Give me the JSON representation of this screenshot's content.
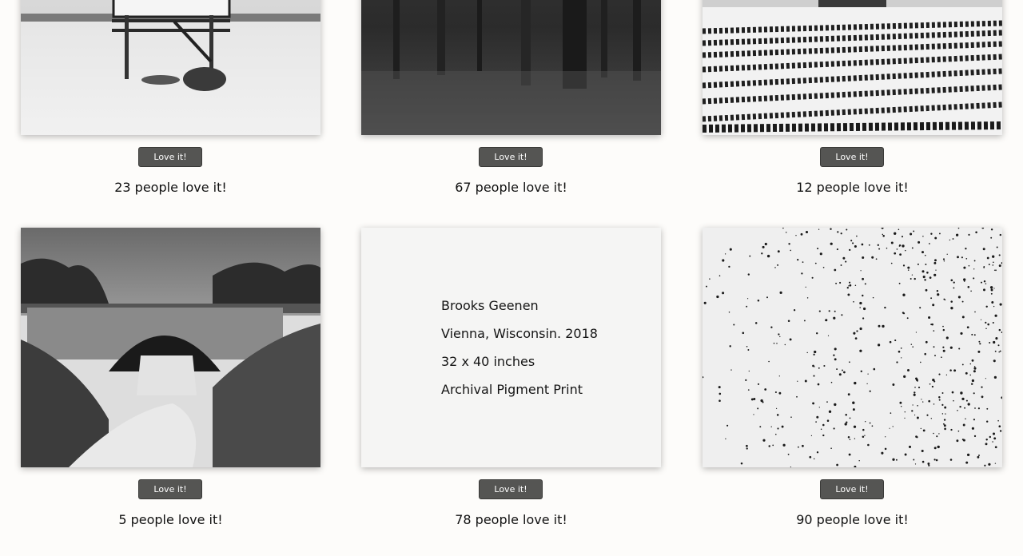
{
  "items": [
    {
      "photo": "snowy-billboard-field",
      "button_label": "Love it!",
      "love_text": "23 people love it!"
    },
    {
      "photo": "dark-forest-floor",
      "button_label": "Love it!",
      "love_text": "67 people love it!"
    },
    {
      "photo": "snowy-cornfield-rows",
      "button_label": "Love it!",
      "love_text": "12 people love it!"
    },
    {
      "photo": "stone-arch-bridge-winter",
      "button_label": "Love it!",
      "love_text": "5 people love it!"
    },
    {
      "photo": "info-card",
      "button_label": "Love it!",
      "love_text": "78 people love it!",
      "info": {
        "artist": "Brooks Geenen",
        "location": "Vienna, Wisconsin. 2018",
        "size": "32 x 40 inches",
        "medium": "Archival Pigment Print"
      }
    },
    {
      "photo": "bird-flock-sky",
      "button_label": "Love it!",
      "love_text": "90 people love it!"
    }
  ],
  "colors": {
    "background": "#fdfcfa",
    "button": "#555553",
    "button_text": "#ffffff",
    "info_panel": "#f5f5f4"
  }
}
